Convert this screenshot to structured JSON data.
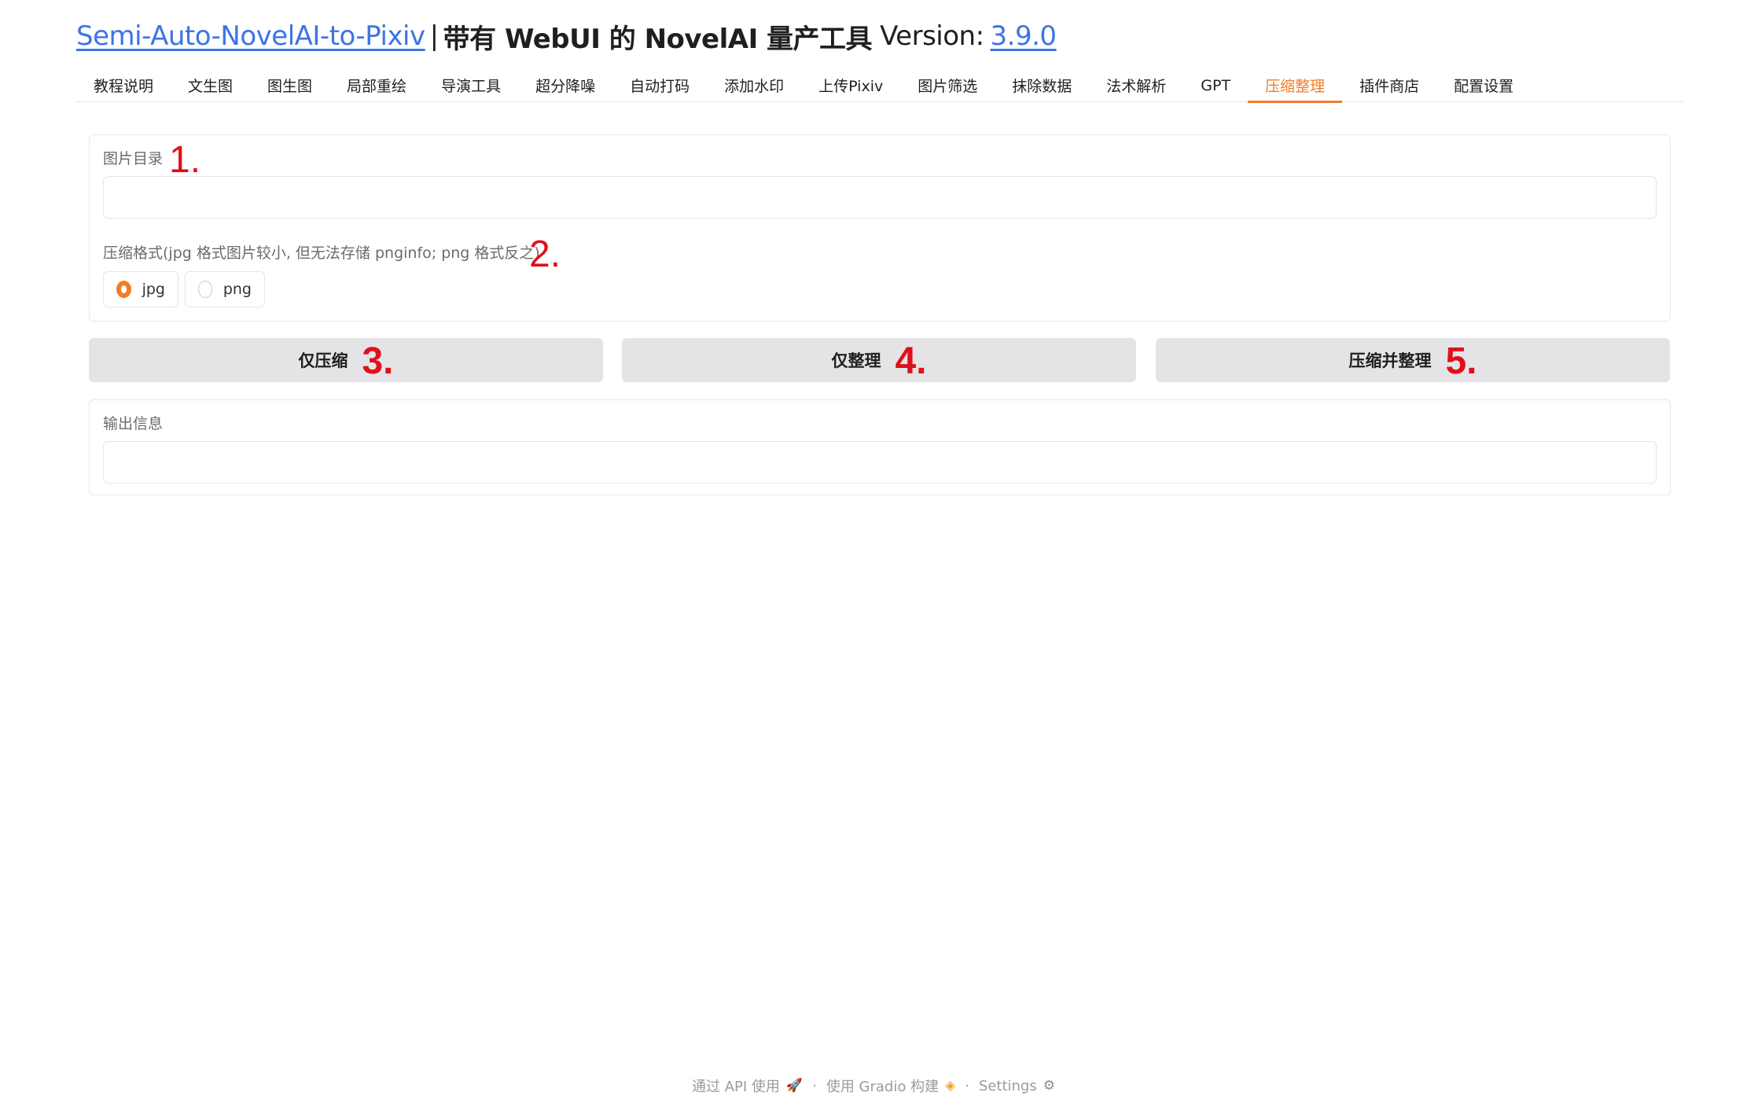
{
  "header": {
    "repo_link": "Semi-Auto-NovelAI-to-Pixiv",
    "separator": "|",
    "title": "带有 WebUI 的 NovelAI 量产工具",
    "version_label": "Version:",
    "version": "3.9.0"
  },
  "tabs": [
    {
      "label": "教程说明"
    },
    {
      "label": "文生图"
    },
    {
      "label": "图生图"
    },
    {
      "label": "局部重绘"
    },
    {
      "label": "导演工具"
    },
    {
      "label": "超分降噪"
    },
    {
      "label": "自动打码"
    },
    {
      "label": "添加水印"
    },
    {
      "label": "上传Pixiv"
    },
    {
      "label": "图片筛选"
    },
    {
      "label": "抹除数据"
    },
    {
      "label": "法术解析"
    },
    {
      "label": "GPT"
    },
    {
      "label": "压缩整理",
      "active": true
    },
    {
      "label": "插件商店"
    },
    {
      "label": "配置设置"
    }
  ],
  "form": {
    "image_dir_label": "图片目录",
    "image_dir_value": "",
    "format_label": "压缩格式(jpg 格式图片较小, 但无法存储 pnginfo; png 格式反之)",
    "format_options": [
      "jpg",
      "png"
    ],
    "format_selected": "jpg",
    "output_label": "输出信息",
    "output_value": ""
  },
  "buttons": {
    "compress_only": "仅压缩",
    "organize_only": "仅整理",
    "compress_and_organize": "压缩并整理"
  },
  "markers": {
    "m1": "1.",
    "m2": "2.",
    "m3": "3.",
    "m4": "4.",
    "m5": "5."
  },
  "footer": {
    "api": "通过 API 使用",
    "built_with": "使用 Gradio 构建",
    "settings": "Settings",
    "dot": "·"
  },
  "colors": {
    "accent": "#f07d2b",
    "link": "#3c74e6",
    "marker": "#e0101a",
    "button_bg": "#e4e4e7"
  },
  "icons": {
    "api": "rocket-icon",
    "gradio": "gradio-logo-icon",
    "settings": "gear-icon"
  }
}
